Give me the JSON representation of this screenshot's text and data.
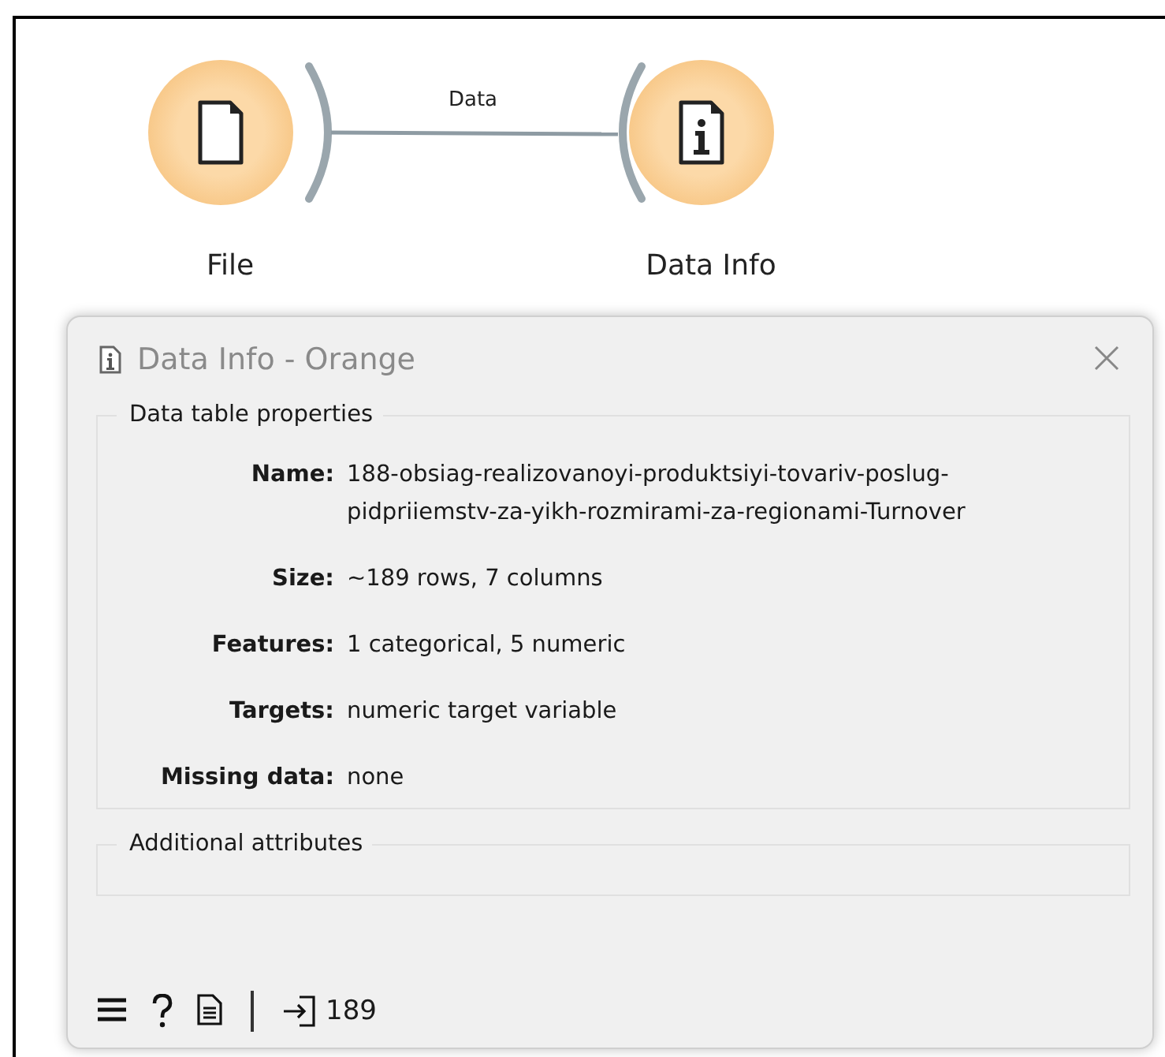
{
  "canvas": {
    "nodes": [
      {
        "label": "File",
        "kind": "file"
      },
      {
        "label": "Data Info",
        "kind": "info"
      }
    ],
    "links": [
      {
        "label": "Data"
      }
    ]
  },
  "window": {
    "title": "Data Info - Orange",
    "groups": [
      {
        "title": "Data table properties",
        "rows": [
          {
            "label": "Name:",
            "lines": [
              "188-obsiag-realizovanoyi-produktsiyi-tovariv-poslug-",
              "pidpriiemstv-za-yikh-rozmirami-za-regionami-Turnover"
            ]
          },
          {
            "label": "Size:",
            "lines": [
              "~189 rows, 7 columns"
            ]
          },
          {
            "label": "Features:",
            "lines": [
              "1 categorical, 5 numeric"
            ]
          },
          {
            "label": "Targets:",
            "lines": [
              "numeric target variable"
            ]
          },
          {
            "label": "Missing data:",
            "lines": [
              "none"
            ]
          }
        ]
      },
      {
        "title": "Additional attributes"
      }
    ],
    "status": {
      "input_count": "189"
    }
  }
}
